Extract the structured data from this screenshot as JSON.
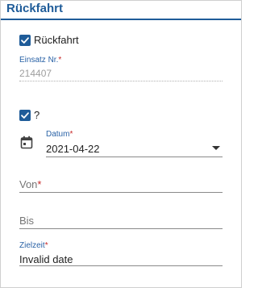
{
  "section": {
    "title": "Rückfahrt"
  },
  "rueckfahrt_checkbox": {
    "label": "Rückfahrt",
    "checked": true
  },
  "einsatz_nr": {
    "label": "Einsatz Nr.",
    "required_mark": "*",
    "value": "214407"
  },
  "question_checkbox": {
    "label": "?",
    "checked": true
  },
  "datum": {
    "label": "Datum",
    "required_mark": "*",
    "value": "2021-04-22",
    "icon": "calendar-icon"
  },
  "von": {
    "label": "Von",
    "required_mark": "*",
    "value": ""
  },
  "bis": {
    "label": "Bis",
    "value": ""
  },
  "zielzeit": {
    "label": "Zielzeit",
    "required_mark": "*",
    "value": "Invalid date"
  },
  "colors": {
    "accent": "#1f5c99",
    "required": "#c62828"
  }
}
